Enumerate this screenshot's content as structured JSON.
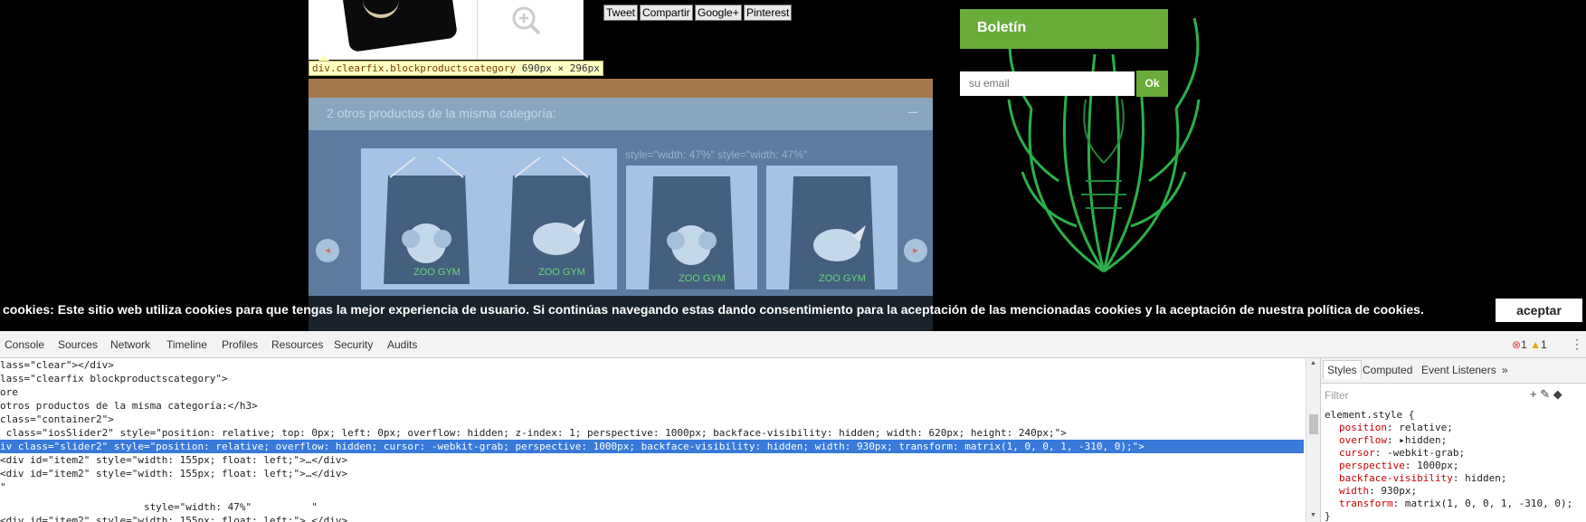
{
  "share_buttons": [
    "Tweet",
    "Compartir",
    "Google+",
    "Pinterest"
  ],
  "newsletter": {
    "title": "Boletín",
    "placeholder": "su email",
    "ok_label": "Ok"
  },
  "inspector_tooltip": {
    "selector": "div.clearfix.blockproductscategory",
    "size": "690px × 296px"
  },
  "category_block": {
    "title": "2 otros productos de la misma categoría:",
    "toggle": "–",
    "ghost_code": "style=\"width: 47%\" style=\"width: 47%\"",
    "prev": "◂",
    "next": "▸"
  },
  "cookie_bar": {
    "text": "cookies: Este sitio web utiliza cookies para que tengas la mejor experiencia de usuario. Si continúas navegando estas dando consentimiento para la aceptación de las mencionadas cookies y la aceptación de nuestra política de cookies.",
    "accept_label": "aceptar"
  },
  "devtools": {
    "tabs": [
      "Console",
      "Sources",
      "Network",
      "Timeline",
      "Profiles",
      "Resources",
      "Security",
      "Audits"
    ],
    "errors": "1",
    "warnings": "1",
    "more": "⋮",
    "code_lines": [
      "lass=\"clear\"></div>",
      "lass=\"clearfix blockproductscategory\">",
      "ore",
      "otros productos de la misma categoría:</h3>",
      "class=\"container2\">",
      " class=\"iosSlider2\" style=\"position: relative; top: 0px; left: 0px; overflow: hidden; z-index: 1; perspective: 1000px; backface-visibility: hidden; width: 620px; height: 240px;\">",
      "iv class=\"slider2\" style=\"position: relative; overflow: hidden; cursor: -webkit-grab; perspective: 1000px; backface-visibility: hidden; width: 930px; transform: matrix(1, 0, 0, 1, -310, 0);\">",
      "<div id=\"item2\" style=\"width: 155px; float: left;\">…</div>",
      "<div id=\"item2\" style=\"width: 155px; float: left;\">…</div>",
      "\"",
      "",
      "                        style=\"width: 47%\"          \"",
      "<div id=\"item2\" style=\"width: 155px; float: left;\">…</div>"
    ],
    "styles": {
      "tabs": [
        "Styles",
        "Computed",
        "Event Listeners",
        "»"
      ],
      "filter_placeholder": "Filter",
      "tool_icons": "+  ✎  ◆",
      "selector": "element.style {",
      "properties": [
        {
          "name": "position",
          "value": "relative;"
        },
        {
          "name": "overflow",
          "value": "▸hidden;"
        },
        {
          "name": "cursor",
          "value": "-webkit-grab;"
        },
        {
          "name": "perspective",
          "value": "1000px;"
        },
        {
          "name": "backface-visibility",
          "value": "hidden;"
        },
        {
          "name": "width",
          "value": "930px;"
        },
        {
          "name": "transform",
          "value": "matrix(1, 0, 0, 1, -310, 0);"
        }
      ],
      "close_brace": "}"
    }
  }
}
